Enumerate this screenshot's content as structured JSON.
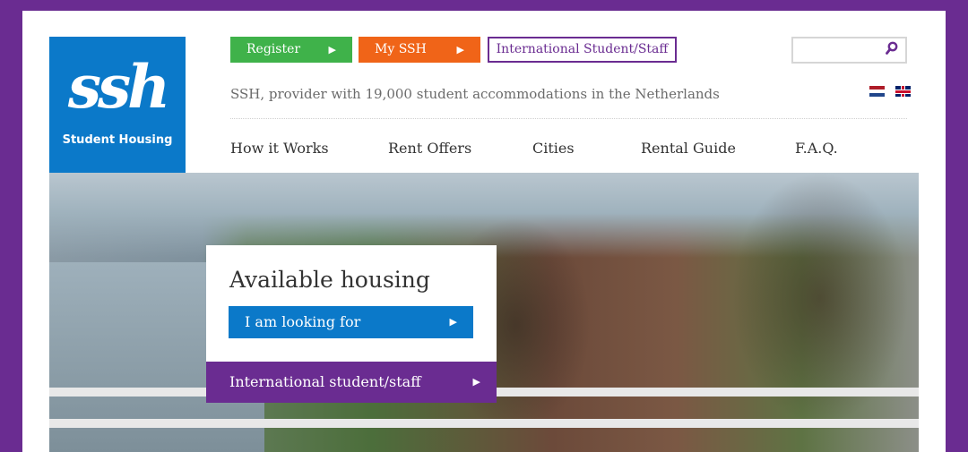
{
  "logo": {
    "mark": "ssh",
    "subtitle": "Student Housing"
  },
  "top_buttons": {
    "register": "Register",
    "my_ssh": "My SSH",
    "international": "International Student/Staff"
  },
  "search": {
    "placeholder": ""
  },
  "tagline": "SSH, provider with 19,000 student accommodations in the Netherlands",
  "languages": [
    "nl-flag-icon",
    "en-flag-icon"
  ],
  "nav": [
    "How it Works",
    "Rent Offers",
    "Cities",
    "Rental Guide",
    "F.A.Q."
  ],
  "hero": {
    "title": "Available housing",
    "looking_button": "I am looking for",
    "international_link": "International student/staff"
  },
  "colors": {
    "brand_purple": "#6a2c91",
    "brand_blue": "#0b79c9",
    "green": "#3fb24a",
    "orange": "#f06418"
  },
  "icons": {
    "arrow": "▶"
  }
}
